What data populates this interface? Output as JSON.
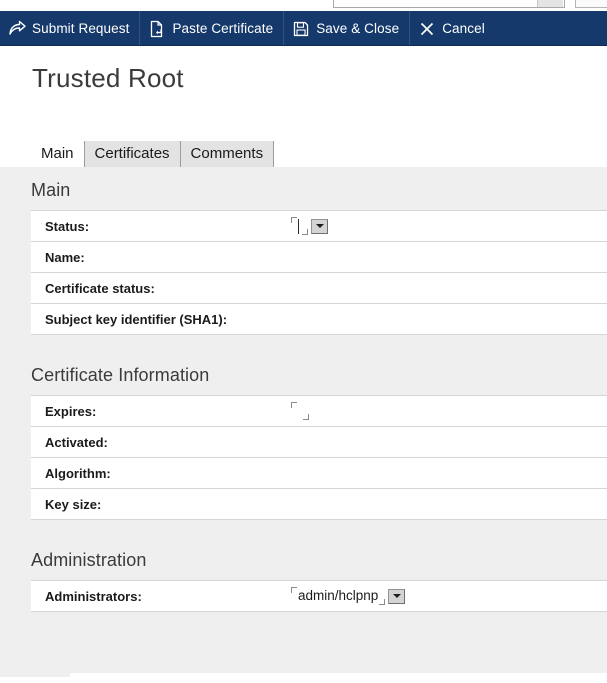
{
  "window": {
    "background_color": "#efefef",
    "accent_color": "#16396b"
  },
  "action_bar": {
    "items": [
      {
        "label": "Submit Request",
        "icon": "forward-arrow-icon"
      },
      {
        "label": "Paste Certificate",
        "icon": "paste-certificate-icon"
      },
      {
        "label": "Save & Close",
        "icon": "save-disk-icon"
      },
      {
        "label": "Cancel",
        "icon": "close-x-icon"
      }
    ]
  },
  "page": {
    "title": "Trusted Root"
  },
  "tabs": [
    {
      "label": "Main",
      "selected": true
    },
    {
      "label": "Certificates",
      "selected": false
    },
    {
      "label": "Comments",
      "selected": false
    }
  ],
  "sections": [
    {
      "title": "Main",
      "rows": [
        {
          "label": "Status:",
          "value": "",
          "field": true,
          "caret": true,
          "dropdown": true
        },
        {
          "label": "Name:",
          "value": "",
          "field": false,
          "caret": false,
          "dropdown": false
        },
        {
          "label": "Certificate status:",
          "value": "",
          "field": false,
          "caret": false,
          "dropdown": false
        },
        {
          "label": "Subject key identifier (SHA1):",
          "value": "",
          "field": false,
          "caret": false,
          "dropdown": false
        }
      ]
    },
    {
      "title": "Certificate Information",
      "rows": [
        {
          "label": "Expires:",
          "value": "",
          "field": true,
          "caret": false,
          "dropdown": false
        },
        {
          "label": "Activated:",
          "value": "",
          "field": false,
          "caret": false,
          "dropdown": false
        },
        {
          "label": "Algorithm:",
          "value": "",
          "field": false,
          "caret": false,
          "dropdown": false
        },
        {
          "label": "Key size:",
          "value": "",
          "field": false,
          "caret": false,
          "dropdown": false
        }
      ]
    },
    {
      "title": "Administration",
      "rows": [
        {
          "label": "Administrators:",
          "value": "admin/hclpnp",
          "field": true,
          "caret": false,
          "dropdown": true
        }
      ]
    }
  ]
}
